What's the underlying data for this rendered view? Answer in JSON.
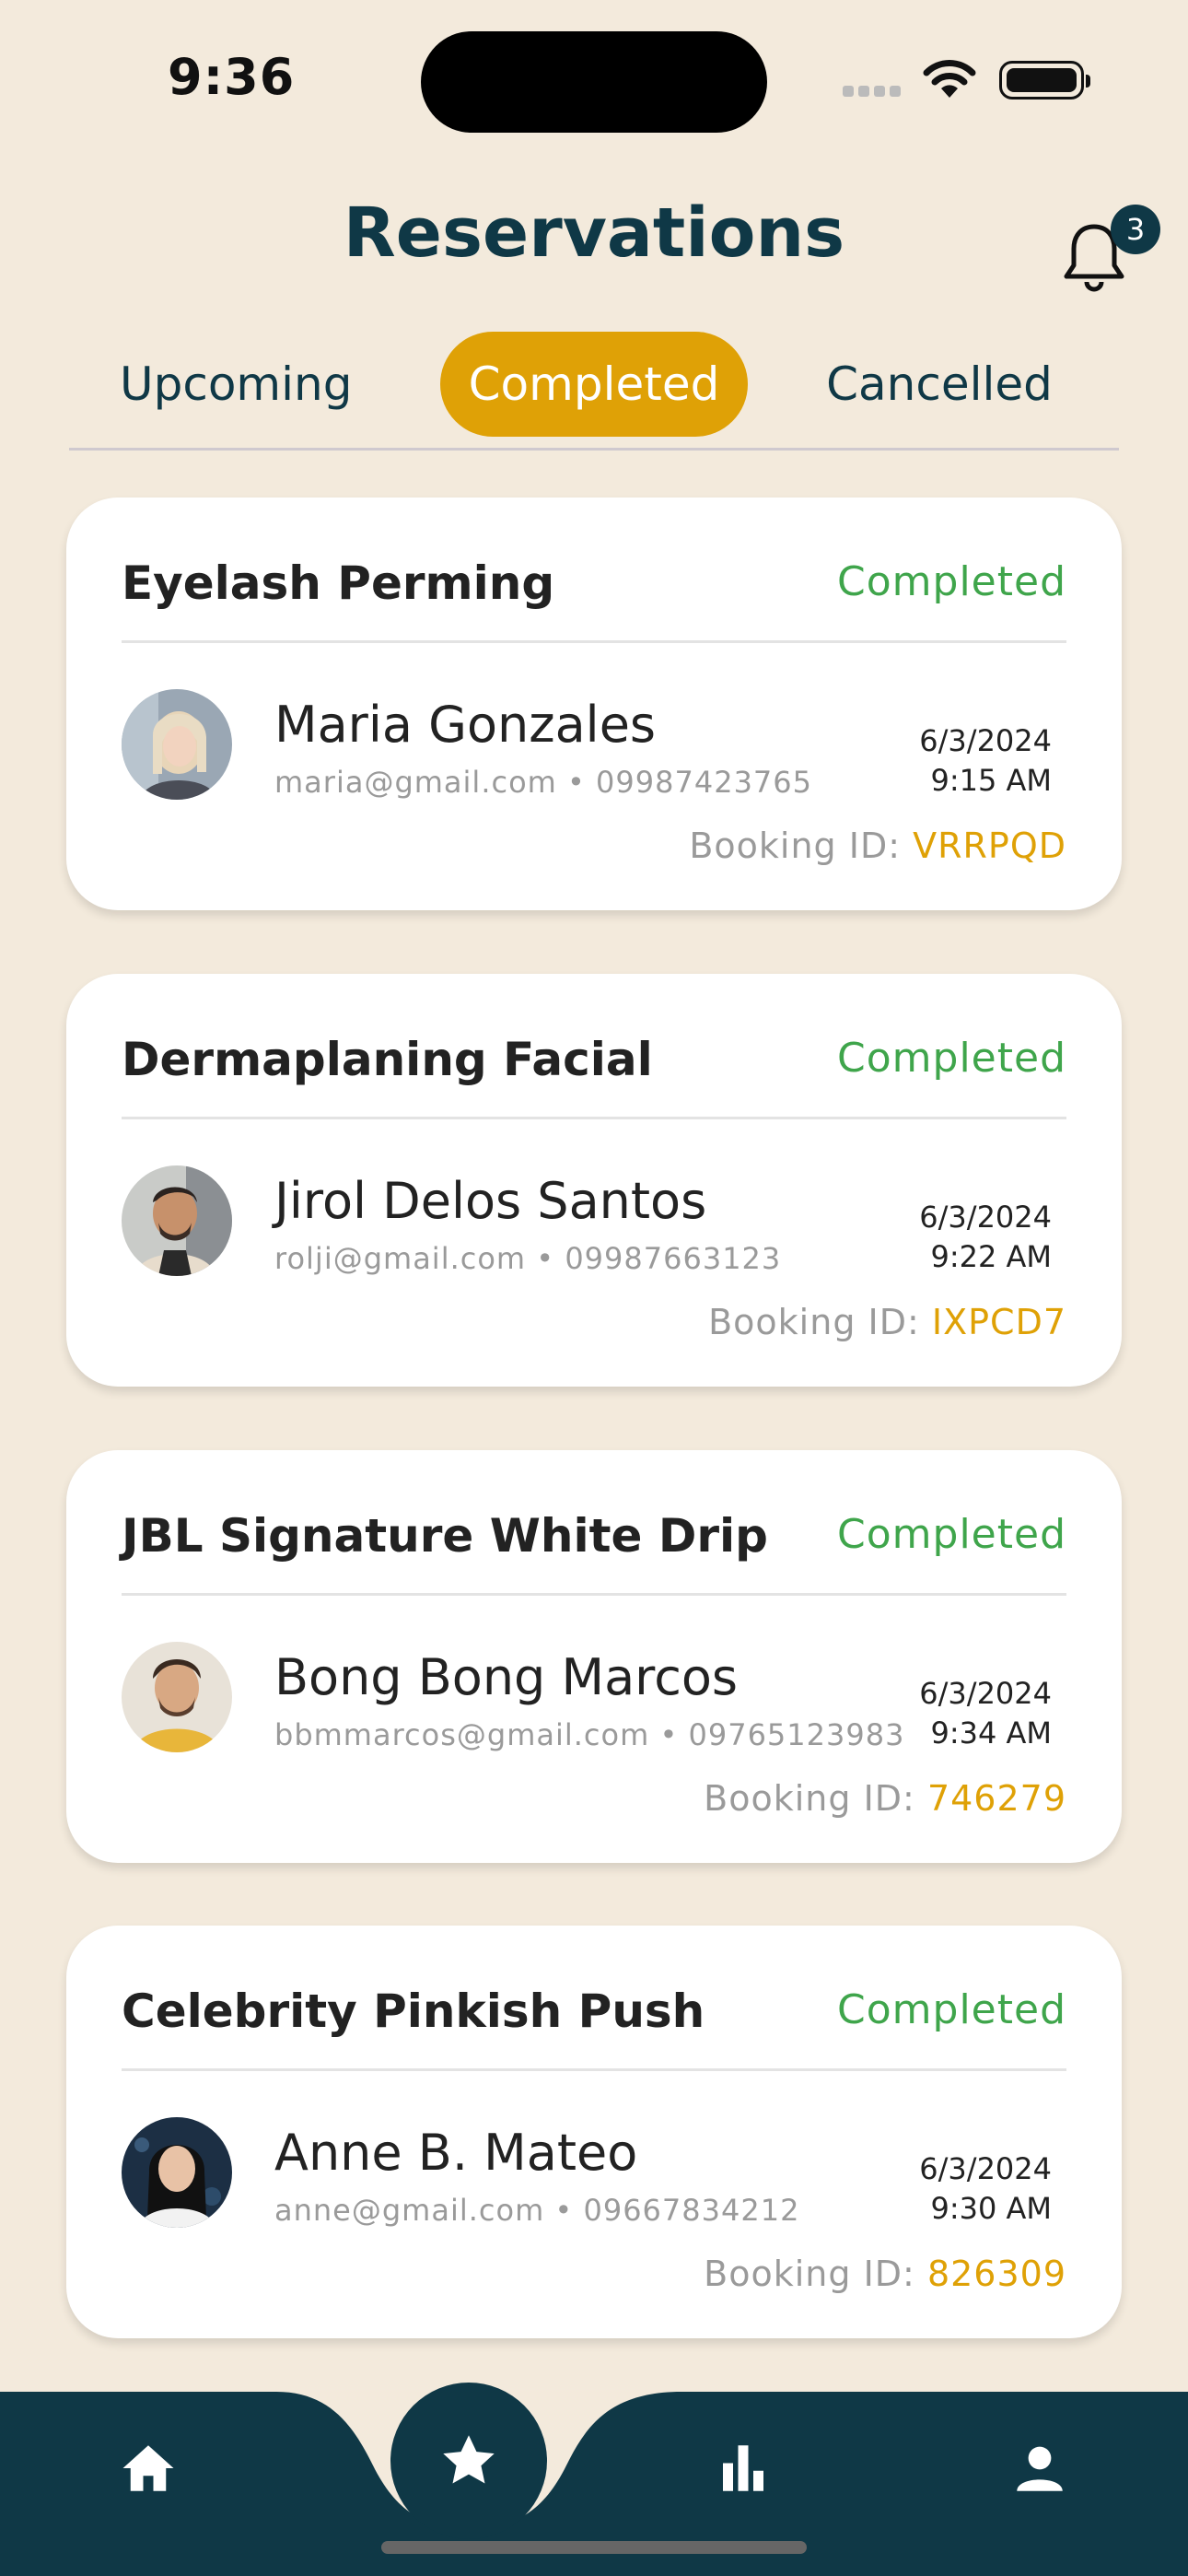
{
  "status_bar": {
    "time": "9:36"
  },
  "header": {
    "title": "Reservations",
    "notification_count": "3"
  },
  "tabs": [
    {
      "label": "Upcoming",
      "active": false
    },
    {
      "label": "Completed",
      "active": true
    },
    {
      "label": "Cancelled",
      "active": false
    }
  ],
  "colors": {
    "accent": "#DFA106",
    "primary": "#0F3846",
    "success": "#3FA54B",
    "background": "#F3EADC"
  },
  "reservations": [
    {
      "service": "Eyelash Perming",
      "status": "Completed",
      "name": "Maria Gonzales",
      "contact": "maria@gmail.com • 09987423765",
      "date": "6/3/2024",
      "time": "9:15 AM",
      "booking_label": "Booking ID: ",
      "booking_id": "VRRPQD"
    },
    {
      "service": "Dermaplaning Facial",
      "status": "Completed",
      "name": "Jirol Delos Santos",
      "contact": "rolji@gmail.com • 09987663123",
      "date": "6/3/2024",
      "time": "9:22 AM",
      "booking_label": "Booking ID: ",
      "booking_id": "IXPCD7"
    },
    {
      "service": "JBL Signature White Drip",
      "status": "Completed",
      "name": "Bong Bong Marcos",
      "contact": "bbmmarcos@gmail.com • 09765123983",
      "date": "6/3/2024",
      "time": "9:34 AM",
      "booking_label": "Booking ID: ",
      "booking_id": "746279"
    },
    {
      "service": "Celebrity Pinkish Push",
      "status": "Completed",
      "name": "Anne B. Mateo",
      "contact": "anne@gmail.com • 09667834212",
      "date": "6/3/2024",
      "time": "9:30 AM",
      "booking_label": "Booking ID: ",
      "booking_id": "826309"
    }
  ],
  "bottom_nav": {
    "items": [
      "home-icon",
      "star-icon",
      "bar-chart-icon",
      "person-icon"
    ]
  }
}
